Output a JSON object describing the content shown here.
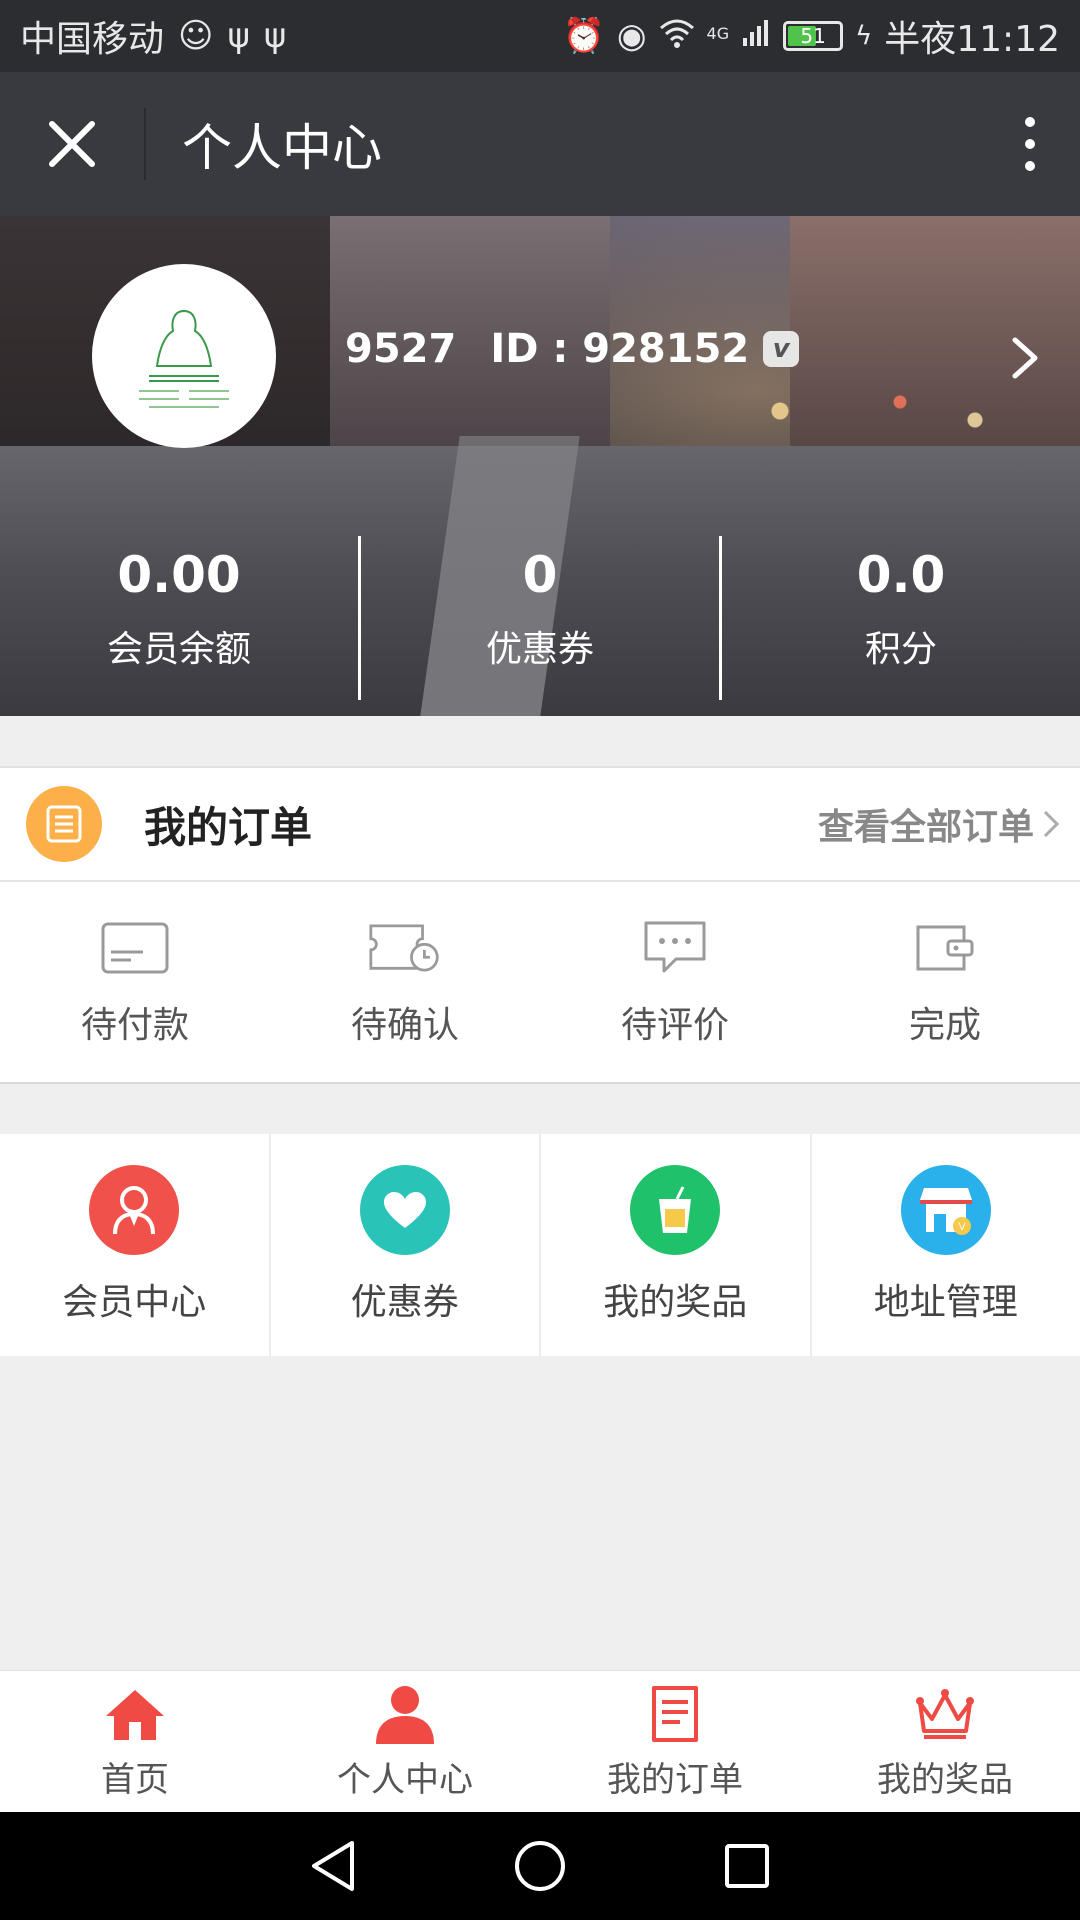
{
  "status_bar": {
    "carrier": "中国移动",
    "network": "4G",
    "battery": "51",
    "time": "半夜11:12"
  },
  "title_bar": {
    "title": "个人中心"
  },
  "profile": {
    "name": "9527",
    "id_text": "ID : 928152",
    "vip_badge": "v"
  },
  "stats": [
    {
      "value": "0.00",
      "label": "会员余额"
    },
    {
      "value": "0",
      "label": "优惠券"
    },
    {
      "value": "0.0",
      "label": "积分"
    }
  ],
  "orders": {
    "title": "我的订单",
    "view_all": "查看全部订单",
    "statuses": [
      {
        "label": "待付款",
        "icon": "card-icon"
      },
      {
        "label": "待确认",
        "icon": "ticket-clock-icon"
      },
      {
        "label": "待评价",
        "icon": "chat-bubble-icon"
      },
      {
        "label": "完成",
        "icon": "wallet-icon"
      }
    ]
  },
  "features": [
    {
      "label": "会员中心",
      "icon": "member-icon",
      "color": "#f0524b"
    },
    {
      "label": "优惠券",
      "icon": "heart-icon",
      "color": "#29c3b7"
    },
    {
      "label": "我的奖品",
      "icon": "cup-icon",
      "color": "#1fc26b"
    },
    {
      "label": "地址管理",
      "icon": "store-icon",
      "color": "#2ab0ea"
    }
  ],
  "tabs": [
    {
      "label": "首页",
      "icon": "home-icon",
      "active": false
    },
    {
      "label": "个人中心",
      "icon": "person-icon",
      "active": true
    },
    {
      "label": "我的订单",
      "icon": "order-icon",
      "active": false
    },
    {
      "label": "我的奖品",
      "icon": "crown-icon",
      "active": false
    }
  ],
  "colors": {
    "accent": "#ef4a43",
    "titlebar": "#393a3f",
    "orders_icon": "#fdb04a"
  }
}
